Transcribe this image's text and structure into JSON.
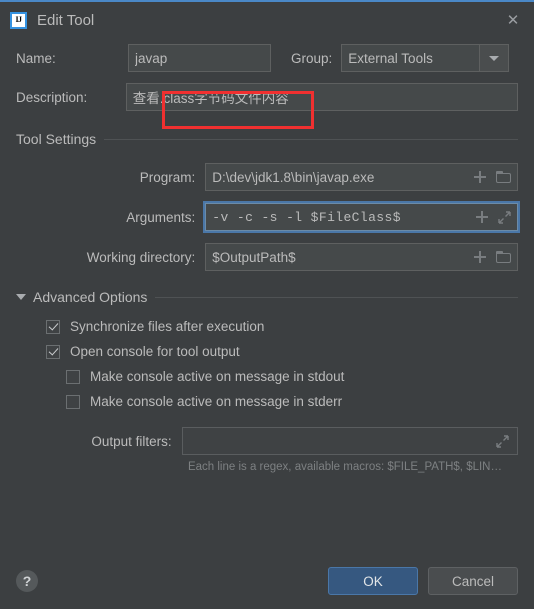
{
  "window": {
    "title": "Edit Tool",
    "app_icon_text": "IJ",
    "close_label": "✕"
  },
  "form": {
    "name_label": "Name:",
    "name_value": "javap",
    "group_label": "Group:",
    "group_value": "External Tools",
    "description_label": "Description:",
    "description_value": "查看.class字节码文件内容"
  },
  "tool_settings": {
    "section_title": "Tool Settings",
    "program_label": "Program:",
    "program_value": "D:\\dev\\jdk1.8\\bin\\javap.exe",
    "arguments_label": "Arguments:",
    "arguments_value": "-v -c -s  -l $FileClass$",
    "working_directory_label": "Working directory:",
    "working_directory_value": "$OutputPath$"
  },
  "advanced": {
    "section_title": "Advanced Options",
    "checkboxes": [
      {
        "label": "Synchronize files after execution",
        "checked": true,
        "indent": false
      },
      {
        "label": "Open console for tool output",
        "checked": true,
        "indent": false
      },
      {
        "label": "Make console active on message in stdout",
        "checked": false,
        "indent": true
      },
      {
        "label": "Make console active on message in stderr",
        "checked": false,
        "indent": true
      }
    ],
    "output_filters_label": "Output filters:",
    "output_filters_value": "",
    "output_filters_hint": "Each line is a regex, available macros: $FILE_PATH$, $LIN…"
  },
  "footer": {
    "help_label": "?",
    "ok_label": "OK",
    "cancel_label": "Cancel"
  },
  "colors": {
    "background": "#3c3f41",
    "accent": "#4a88c7",
    "ok_button": "#365880",
    "annotation": "#f03030",
    "focus_ring": "#4a77a8"
  }
}
